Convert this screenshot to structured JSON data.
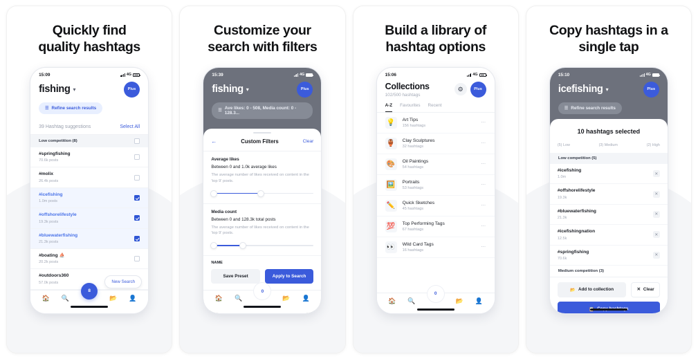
{
  "cards": [
    {
      "headline": "Quickly find\nquality hashtags",
      "phone": {
        "time": "15:09",
        "network": "4G",
        "query": "fishing",
        "plus_label": "Plus",
        "refine_label": "Refine search results",
        "suggestions_label": "39 Hashtag suggestions",
        "select_all_label": "Select All",
        "group_label": "Low competition (8)",
        "rows": [
          {
            "tag": "#springfishing",
            "count": "70.6k posts",
            "selected": false
          },
          {
            "tag": "#molix",
            "count": "26.4k posts",
            "selected": false
          },
          {
            "tag": "#icefishing",
            "count": "1.0m posts",
            "selected": true
          },
          {
            "tag": "#offshorelifestyle",
            "count": "19.3k posts",
            "selected": true
          },
          {
            "tag": "#bluewaterfishing",
            "count": "21.3k posts",
            "selected": true
          },
          {
            "tag": "#boating",
            "count": "20.2k posts",
            "selected": false
          },
          {
            "tag": "#outdoors360",
            "count": "57.0k posts",
            "selected": false
          }
        ],
        "new_search_label": "New Search",
        "fab_badge": "8",
        "active_nav": "search"
      }
    },
    {
      "headline": "Customize your\nsearch with filters",
      "phone": {
        "time": "15:39",
        "network": "4G",
        "query": "fishing",
        "plus_label": "Plus",
        "refine_label": "Ave likes: 0 - 508, Media count: 0 - 128.3...",
        "sheet_title": "Custom Filters",
        "clear_label": "Clear",
        "filters": [
          {
            "label": "Average likes",
            "value": "Between 0 and 1.0k average likes",
            "desc": "The average number of likes received on content in the 'top 9' posts.",
            "fill_start": 3,
            "fill_end": 50
          },
          {
            "label": "Media count",
            "value": "Between 0 and 128.3k total posts",
            "desc": "The average number of likes received on content in the 'top 9' posts.",
            "fill_start": 3,
            "fill_end": 32
          }
        ],
        "name_label": "NAME",
        "save_preset_label": "Save Preset",
        "apply_label": "Apply to Search",
        "fab_badge": "0",
        "active_nav": "search"
      }
    },
    {
      "headline": "Build a library of\nhashtag options",
      "phone": {
        "time": "15:06",
        "network": "4G",
        "title": "Collections",
        "subtitle": "102/500 hashtags",
        "plus_label": "Plus",
        "tabs": [
          {
            "label": "A-Z",
            "active": true
          },
          {
            "label": "Favourites",
            "active": false
          },
          {
            "label": "Recent",
            "active": false
          }
        ],
        "collections": [
          {
            "icon": "💡",
            "name": "Art Tips",
            "meta": "156 hashtags"
          },
          {
            "icon": "🏺",
            "name": "Clay Sculptures",
            "meta": "32 hashtags"
          },
          {
            "icon": "🎨",
            "name": "Oil Paintings",
            "meta": "54 hashtags"
          },
          {
            "icon": "🖼️",
            "name": "Portraits",
            "meta": "53 hashtags"
          },
          {
            "icon": "✏️",
            "name": "Quick Sketches",
            "meta": "45 hashtags"
          },
          {
            "icon": "💯",
            "name": "Top Performing  Tags",
            "meta": "67 hashtags"
          },
          {
            "icon": "👀",
            "name": "Wild Card Tags",
            "meta": "16 hashtags"
          }
        ],
        "fab_badge": "0",
        "active_nav": "collections"
      }
    },
    {
      "headline": "Copy hashtags in a\nsingle tap",
      "phone": {
        "time": "15:10",
        "network": "4G",
        "query": "icefishing",
        "plus_label": "Plus",
        "refine_label": "Refine search results",
        "selected_title": "10 hashtags selected",
        "segments": [
          {
            "label": "(5) Low",
            "value": 5
          },
          {
            "label": "(3) Medium",
            "value": 3
          },
          {
            "label": "(2) High",
            "value": 2
          }
        ],
        "group_label": "Low competition (5)",
        "rows": [
          {
            "tag": "#icefishing",
            "count": "1.0m"
          },
          {
            "tag": "#offshorelifestyle",
            "count": "19.3k"
          },
          {
            "tag": "#bluewaterfishing",
            "count": "21.3k"
          },
          {
            "tag": "#icefishingnation",
            "count": "12.5k"
          },
          {
            "tag": "#springfishing",
            "count": "70.6k"
          }
        ],
        "next_group_label": "Medium competition (3)",
        "add_to_collection_label": "Add to collection",
        "clear_label": "Clear",
        "copy_label": "Copy hashtags"
      }
    }
  ],
  "colors": {
    "accent": "#3b5bdb",
    "accent_dark": "#2f55d4",
    "text": "#16181d",
    "muted": "#a3a9b6"
  }
}
